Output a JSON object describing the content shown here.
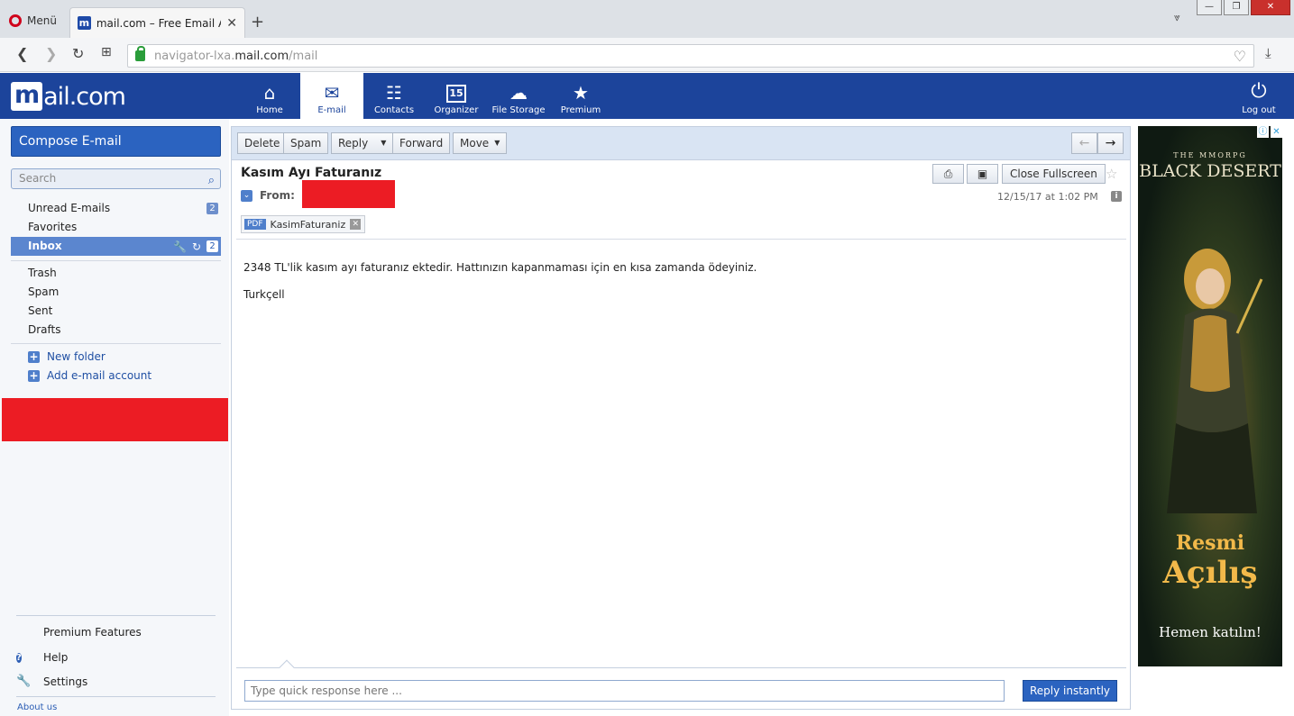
{
  "browser": {
    "menu_label": "Menü",
    "tab_title": "mail.com – Free Email Acco",
    "favicon_letter": "m",
    "url_prefix": "navigator-lxa.",
    "url_domain": "mail.com",
    "url_path": "/mail"
  },
  "header": {
    "logo_m": "m",
    "logo_rest": "ail.com",
    "nav": [
      {
        "label": "Home",
        "icon": "home-icon"
      },
      {
        "label": "E-mail",
        "icon": "envelope-icon"
      },
      {
        "label": "Contacts",
        "icon": "contacts-icon"
      },
      {
        "label": "Organizer",
        "icon": "calendar-icon"
      },
      {
        "label": "File Storage",
        "icon": "cloud-icon"
      },
      {
        "label": "Premium",
        "icon": "star-icon"
      }
    ],
    "calendar_day": "15",
    "logout_label": "Log out"
  },
  "sidebar": {
    "compose_label": "Compose E-mail",
    "search_placeholder": "Search",
    "folders": [
      {
        "label": "Unread E-mails",
        "count": "2"
      },
      {
        "label": "Favorites"
      },
      {
        "label": "Inbox",
        "count": "2"
      },
      {
        "label": "Trash"
      },
      {
        "label": "Spam"
      },
      {
        "label": "Sent"
      },
      {
        "label": "Drafts"
      }
    ],
    "new_folder": "New folder",
    "add_account": "Add e-mail account",
    "premium_features": "Premium Features",
    "help": "Help",
    "settings": "Settings",
    "about": "About us"
  },
  "toolbar": {
    "delete": "Delete",
    "spam": "Spam",
    "reply": "Reply",
    "forward": "Forward",
    "move": "Move"
  },
  "message": {
    "subject": "Kasım Ayı Faturanız",
    "from_label": "From:",
    "from_prefix": "(",
    "date": "12/15/17 at 1:02 PM",
    "close_fullscreen": "Close Fullscreen",
    "attachment_type": "PDF",
    "attachment_name": "KasimFaturaniz",
    "body": [
      "2348 TL'lik kasım ayı faturanız ektedir. Hattınızın kapanmaması için en kısa zamanda ödeyiniz.",
      "Turkçell"
    ],
    "quick_placeholder": "Type quick response here ...",
    "reply_instantly": "Reply instantly"
  },
  "ad": {
    "mmorpg": "THE MMORPG",
    "title": "BLACK DESERT",
    "line1": "Resmi",
    "line2": "Açılış",
    "cta": "Hemen katılın!"
  },
  "colors": {
    "brand_blue": "#1c449b",
    "active_folder": "#5b86cf",
    "redaction": "#ec1c24"
  }
}
